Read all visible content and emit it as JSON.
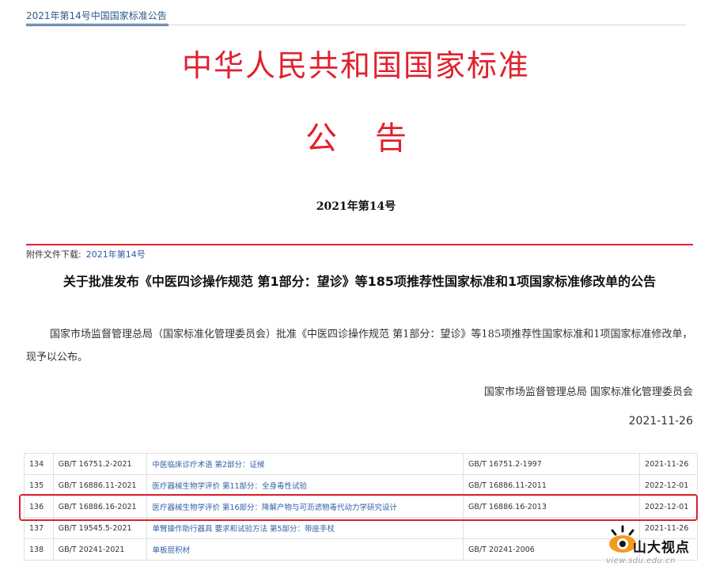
{
  "header": {
    "breadcrumb": "2021年第14号中国国家标准公告"
  },
  "document": {
    "main_title": "中华人民共和国国家标准",
    "sub_title": "公告",
    "issue_no": "2021年第14号",
    "attachment_label": "附件文件下载:",
    "attachment_link": "2021年第14号",
    "notice_title": "关于批准发布《中医四诊操作规范 第1部分：望诊》等185项推荐性国家标准和1项国家标准修改单的公告",
    "body": "国家市场监督管理总局（国家标准化管理委员会）批准《中医四诊操作规范 第1部分：望诊》等185项推荐性国家标准和1项国家标准修改单，现予以公布。",
    "issuer": "国家市场监督管理总局 国家标准化管理委员会",
    "date": "2021-11-26"
  },
  "table": {
    "rows": [
      {
        "num": "134",
        "code": "GB/T 16751.2-2021",
        "name": "中医临床诊疗术语 第2部分：证候",
        "replaces": "GB/T 16751.2-1997",
        "date": "2021-11-26"
      },
      {
        "num": "135",
        "code": "GB/T 16886.11-2021",
        "name": "医疗器械生物学评价 第11部分：全身毒性试验",
        "replaces": "GB/T 16886.11-2011",
        "date": "2022-12-01"
      },
      {
        "num": "136",
        "code": "GB/T 16886.16-2021",
        "name": "医疗器械生物学评价 第16部分：降解产物与可沥滤物毒代动力学研究设计",
        "replaces": "GB/T 16886.16-2013",
        "date": "2022-12-01"
      },
      {
        "num": "137",
        "code": "GB/T 19545.5-2021",
        "name": "单臂操作助行器具 要求和试验方法 第5部分：带座手杖",
        "replaces": "",
        "date": "2021-11-26"
      },
      {
        "num": "138",
        "code": "GB/T 20241-2021",
        "name": "单板层积材",
        "replaces": "GB/T 20241-2006",
        "date": ""
      }
    ]
  },
  "watermark": {
    "text": "山大视点",
    "url": "view.sdu.edu.cn"
  },
  "colors": {
    "accent_red": "#e0212e",
    "link_blue": "#2c5fa5",
    "header_blue": "#2b5a8a"
  }
}
